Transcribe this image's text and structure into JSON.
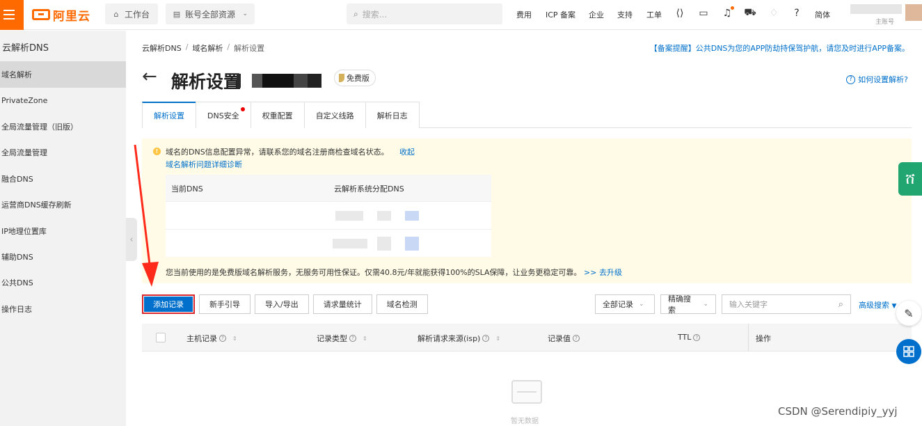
{
  "topbar": {
    "logo_text": "阿里云",
    "workbench": "工作台",
    "resources": "账号全部资源",
    "search_placeholder": "搜索...",
    "links": [
      "费用",
      "ICP 备案",
      "企业",
      "支持",
      "工单"
    ],
    "lang": "简体",
    "account_sub": "主账号",
    "brand_color": "#ff6a00"
  },
  "sidebar": {
    "title": "云解析DNS",
    "items": [
      {
        "label": "域名解析",
        "active": true
      },
      {
        "label": "PrivateZone"
      },
      {
        "label": "全局流量管理（旧版）"
      },
      {
        "label": "全局流量管理"
      },
      {
        "label": "融合DNS"
      },
      {
        "label": "运营商DNS缓存刷新"
      },
      {
        "label": "IP地理位置库"
      },
      {
        "label": "辅助DNS"
      },
      {
        "label": "公共DNS"
      },
      {
        "label": "操作日志"
      }
    ]
  },
  "breadcrumb": [
    "云解析DNS",
    "域名解析",
    "解析设置"
  ],
  "notice": "【备案提醒】公共DNS为您的APP防劫持保驾护航，请您及时进行APP备案。",
  "page": {
    "title": "解析设置",
    "badge": "免费版",
    "help": "如何设置解析?"
  },
  "tabs": [
    {
      "label": "解析设置",
      "active": true
    },
    {
      "label": "DNS安全",
      "dot": true
    },
    {
      "label": "权重配置"
    },
    {
      "label": "自定义线路"
    },
    {
      "label": "解析日志"
    }
  ],
  "warning": {
    "text": "域名的DNS信息配置异常，请联系您的域名注册商检查域名状态。",
    "collapse": "收起",
    "diag_link": "域名解析问题详细诊断",
    "col_current": "当前DNS",
    "col_assigned": "云解析系统分配DNS",
    "upgrade_text": "您当前使用的是免费版域名解析服务，无服务可用性保证。仅需40.8元/年就能获得100%的SLA保障，让业务更稳定可靠。",
    "upgrade_link": ">> 去升级"
  },
  "actions": [
    "添加记录",
    "新手引导",
    "导入/导出",
    "请求量统计",
    "域名检测"
  ],
  "filters": {
    "record_type": "全部记录",
    "match": "精确搜索",
    "keyword_placeholder": "输入关键字",
    "advanced": "高级搜索"
  },
  "columns": [
    "主机记录",
    "记录类型",
    "解析请求来源(isp)",
    "记录值",
    "TTL",
    "操作"
  ],
  "empty": "暂无数据",
  "watermark": "CSDN @Serendipiy_yyj",
  "accent_color": "#0070cc"
}
